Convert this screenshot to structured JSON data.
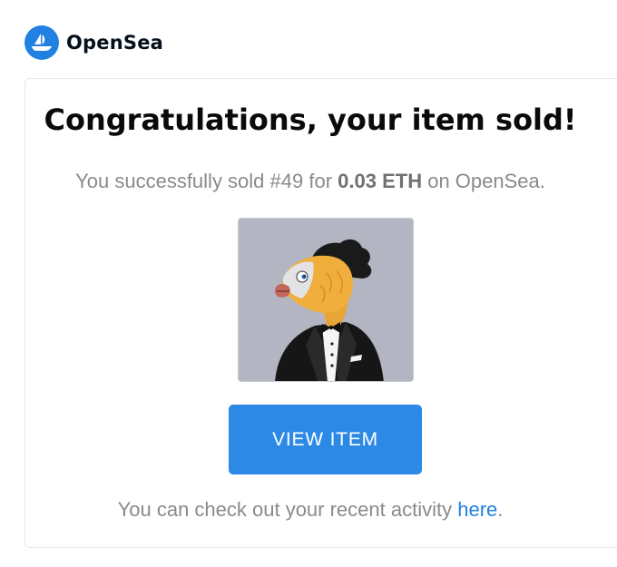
{
  "brand": {
    "name": "OpenSea",
    "logo_icon": "opensea-boat-icon",
    "color": "#2081e2"
  },
  "card": {
    "headline": "Congratulations, your item sold!",
    "sale": {
      "prefix": "You successfully sold ",
      "item_number": "#49",
      "middle": " for ",
      "price": "0.03 ETH",
      "suffix": " on OpenSea."
    },
    "nft_image": {
      "icon": "fish-in-tuxedo-nft-image",
      "background": "#b3b6c2"
    },
    "button": {
      "label": "VIEW ITEM",
      "color": "#2c8ae6"
    },
    "footer": {
      "prefix": "You can check out your recent activity ",
      "link_text": "here",
      "suffix": "."
    }
  }
}
